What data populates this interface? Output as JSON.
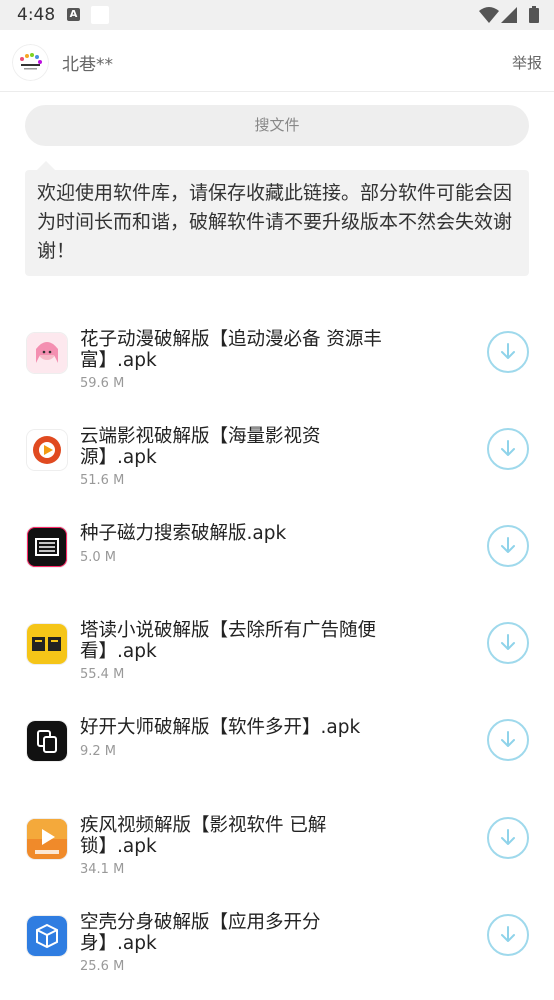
{
  "status_bar": {
    "time": "4:48",
    "notification_icon": "A"
  },
  "header": {
    "name": "北巷**",
    "report": "举报"
  },
  "search": {
    "placeholder": "搜文件"
  },
  "notice": {
    "text": "欢迎使用软件库，请保存收藏此链接。部分软件可能会因为时间长而和谐，破解软件请不要升级版本不然会失效谢谢！"
  },
  "files": [
    {
      "title": "花子动漫破解版【追动漫必备 资源丰富】.apk",
      "size": "59.6 M",
      "icon": "anime-girl-icon",
      "color": "#f9d5df"
    },
    {
      "title": "云端影视破解版【海量影视资源】.apk",
      "size": "51.6 M",
      "icon": "cloud-video-icon",
      "color": "#e04a20"
    },
    {
      "title": "种子磁力搜索破解版.apk",
      "size": "5.0 M",
      "icon": "magnet-search-icon",
      "color": "#111111"
    },
    {
      "title": "塔读小说破解版【去除所有广告随便看】.apk",
      "size": "55.4 M",
      "icon": "tadu-novel-icon",
      "color": "#f5c518"
    },
    {
      "title": "好开大师破解版【软件多开】.apk",
      "size": "9.2 M",
      "icon": "multi-open-icon",
      "color": "#111111"
    },
    {
      "title": "疾风视频解版【影视软件 已解锁】.apk",
      "size": "34.1 M",
      "icon": "video-play-icon",
      "color": "#f08a2a"
    },
    {
      "title": "空壳分身破解版【应用多开分身】.apk",
      "size": "25.6 M",
      "icon": "cube-clone-icon",
      "color": "#2f7de1"
    }
  ]
}
